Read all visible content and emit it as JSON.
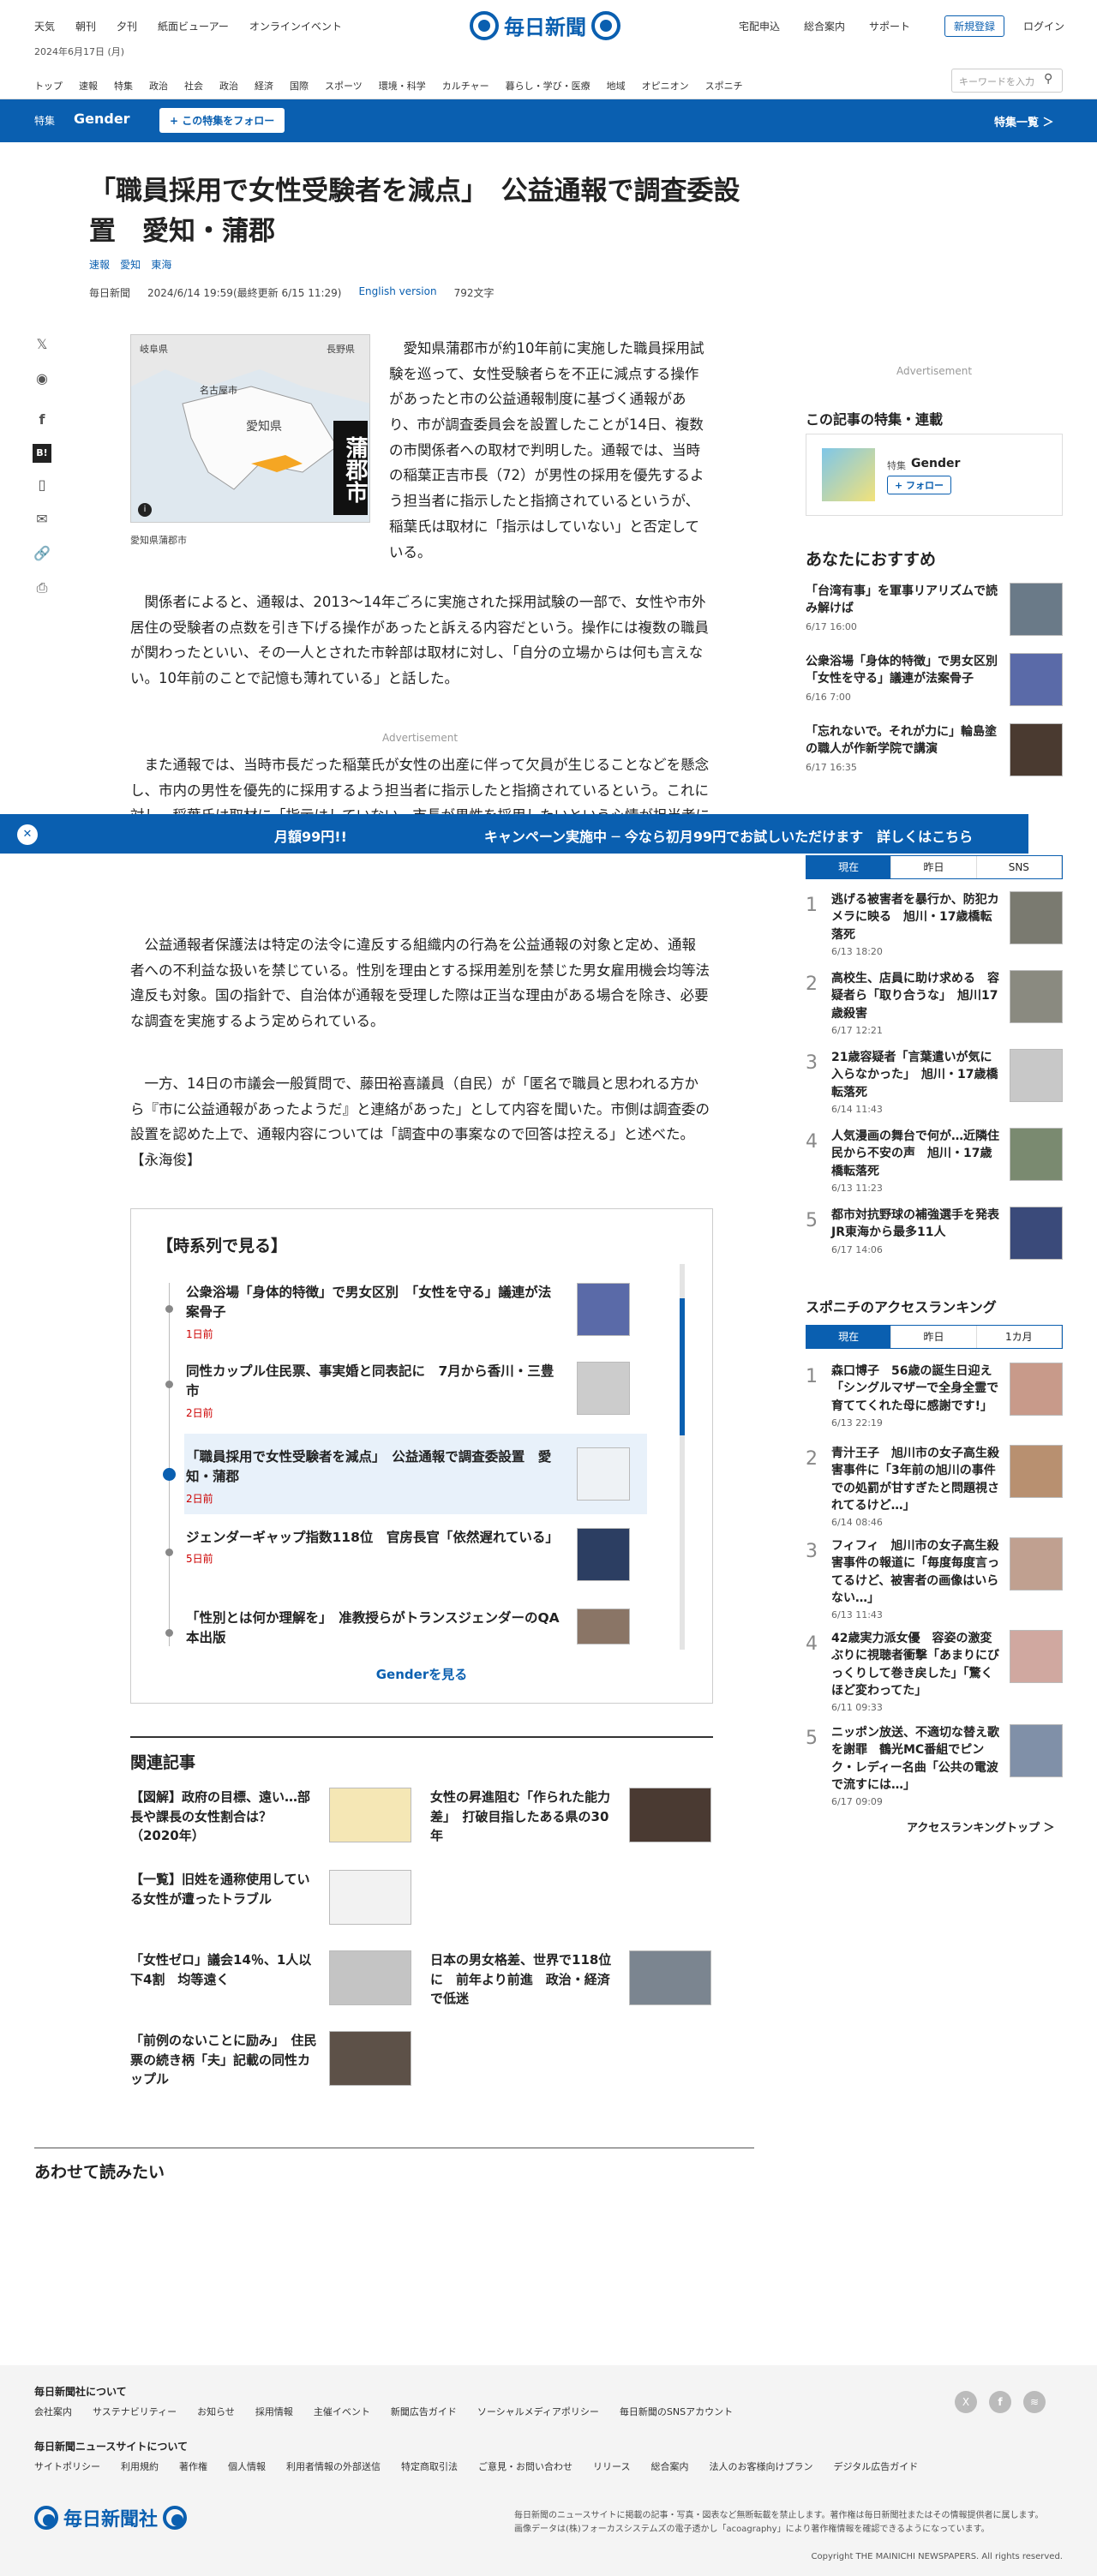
{
  "header": {
    "left_nav": [
      "天気",
      "朝刊",
      "夕刊",
      "紙面ビューアー",
      "オンラインイベント"
    ],
    "date": "2024年6月17日 (月)",
    "logo_text": "毎日新聞",
    "right_nav": [
      "宅配申込",
      "総合案内",
      "サポート"
    ],
    "register_label": "新規登録",
    "login_label": "ログイン",
    "categories": [
      "トップ",
      "速報",
      "特集",
      "政治",
      "社会",
      "政治",
      "経済",
      "国際",
      "スポーツ",
      "環境・科学",
      "カルチャー",
      "暮らし・学び・医療",
      "地域",
      "オピニオン",
      "スポニチ"
    ],
    "search_placeholder": "キーワードを入力"
  },
  "feature_band": {
    "kicker": "特集",
    "name": "Gender",
    "follow_label": "+ この特集をフォロー",
    "list_label": "特集一覧 ＞"
  },
  "article": {
    "title": "「職員採用で女性受験者を減点」　公益通報で調査委設置　愛知・蒲郡",
    "tags": [
      "速報",
      "愛知",
      "東海"
    ],
    "source": "毎日新聞",
    "datetime": "2024/6/14 19:59(最終更新 6/15 11:29)",
    "english_version": "English version",
    "chars": "792文字",
    "map_labels": {
      "pref_left": "岐阜県",
      "pref_right": "長野県",
      "city": "名古屋市",
      "pref": "愛知県",
      "target": "蒲郡市"
    },
    "map_caption": "愛知県蒲郡市",
    "p1": "　愛知県蒲郡市が約10年前に実施した職員採用試験を巡って、女性受験者らを不正に減点する操作があったと市の公益通報制度に基づく通報があり、市が調査委員会を設置したことが14日、複数の市関係者への取材で判明した。通報では、当時の稲葉正吉市長（72）が男性の採用を優先するよう担当者に指示したと指摘されているというが、稲葉氏は取材に「指示はしていない」と否定している。",
    "p2": "　関係者によると、通報は、2013～14年ごろに実施された採用試験の一部で、女性や市外居住の受験者の点数を引き下げる操作があったと訴える内容だという。操作には複数の職員が関わったといい、その一人とされた市幹部は取材に対し、「自分の立場からは何も言えない。10年前のことで記憶も薄れている」と話した。",
    "ad_label": "Advertisement",
    "p3": "　また通報では、当時市長だった稲葉氏が女性の出産に伴って欠員が生じることなどを懸念し、市内の男性を優先的に採用するよう担当者に指示したと指摘されているという。これに対し、稲葉氏は取材に「指示はしていない。市長が男性を採用したいという心情が担当者にはあると思う。だが、試験はあくまで公平でなければならない」と語った。",
    "p4": "　公益通報者保護法は特定の法令に違反する組織内の行為を公益通報の対象と定め、通報者への不利益な扱いを禁じている。性別を理由とする採用差別を禁じた男女雇用機会均等法違反も対象。国の指針で、自治体が通報を受理した際は正当な理由がある場合を除き、必要な調査を実施するよう定められている。",
    "p5": "　一方、14日の市議会一般質問で、藤田裕喜議員（自民）が「匿名で職員と思われる方から『市に公益通報があったようだ』と連絡があった」として内容を聞いた。市側は調査委の設置を認めた上で、通報内容については「調査中の事案なので回答は控える」と述べた。【永海俊】"
  },
  "banner": {
    "text": "月額99円!!　　　　　　　　　　キャンペーン実施中 ─ 今なら初月99円でお試しいただけます　詳しくはこちら"
  },
  "timeline": {
    "heading": "【時系列で見る】",
    "items": [
      {
        "title": "公衆浴場「身体的特徴」で男女区別　「女性を守る」議連が法案骨子",
        "date": "1日前"
      },
      {
        "title": "同性カップル住民票、事実婚と同表記に　7月から香川・三豊市",
        "date": "2日前"
      },
      {
        "title": "「職員採用で女性受験者を減点」　公益通報で調査委設置　愛知・蒲郡",
        "date": "2日前"
      },
      {
        "title": "ジェンダーギャップ指数118位　官房長官「依然遅れている」",
        "date": "5日前"
      },
      {
        "title": "「性別とは何か理解を」　准教授らがトランスジェンダーのQA本出版",
        "date": ""
      }
    ],
    "more_label": "Genderを見る"
  },
  "related": {
    "heading": "関連記事",
    "items": [
      {
        "title": "【図解】政府の目標、遠い…部長や課長の女性割合は？（2020年）"
      },
      {
        "title": "女性の昇進阻む「作られた能力差」　打破目指したある県の30年"
      },
      {
        "title": "【一覧】旧姓を通称使用している女性が遭ったトラブル"
      },
      {
        "title": "「女性ゼロ」議会14％、1人以下4割　均等遠く"
      },
      {
        "title": "日本の男女格差、世界で118位に　前年より前進　政治・経済で低迷"
      },
      {
        "title": "「前例のないことに励み」　住民票の続き柄「夫」記載の同性カップル"
      }
    ]
  },
  "read_also": {
    "heading": "あわせて読みたい"
  },
  "right": {
    "ad_label": "Advertisement",
    "feature_heading": "この記事の特集・連載",
    "feature_kicker": "特集",
    "feature_name": "Gender",
    "feature_follow": "+ フォロー",
    "reco_heading": "あなたにおすすめ",
    "reco": [
      {
        "title": "「台湾有事」を軍事リアリズムで読み解けば",
        "date": "6/17 16:00"
      },
      {
        "title": "公衆浴場「身体的特徴」で男女区別「女性を守る」議連が法案骨子",
        "date": "6/16 7:00"
      },
      {
        "title": "「忘れないで。それが力に」輪島塗の職人が作新学院で講演",
        "date": "6/17 16:35"
      }
    ],
    "tabs1": [
      "現在",
      "昨日",
      "SNS"
    ],
    "rank1": [
      {
        "n": "1",
        "title": "逃げる被害者を暴行か、防犯カメラに映る　旭川・17歳橋転落死",
        "date": "6/13 18:20"
      },
      {
        "n": "2",
        "title": "高校生、店員に助け求める　容疑者ら「取り合うな」　旭川17歳殺害",
        "date": "6/17 12:21"
      },
      {
        "n": "3",
        "title": "21歳容疑者「言葉遣いが気に入らなかった」　旭川・17歳橋転落死",
        "date": "6/14 11:43"
      },
      {
        "n": "4",
        "title": "人気漫画の舞台で何が…近隣住民から不安の声　旭川・17歳橋転落死",
        "date": "6/13 11:23"
      },
      {
        "n": "5",
        "title": "都市対抗野球の補強選手を発表　JR東海から最多11人",
        "date": "6/17 14:06"
      }
    ],
    "sponichi_heading": "スポニチのアクセスランキング",
    "tabs2": [
      "現在",
      "昨日",
      "1カ月"
    ],
    "rank2": [
      {
        "n": "1",
        "title": "森口博子　56歳の誕生日迎え「シングルマザーで全身全霊で育ててくれた母に感謝です!」",
        "date": "6/13 22:19"
      },
      {
        "n": "2",
        "title": "青汁王子　旭川市の女子高生殺害事件に「3年前の旭川の事件での処罰が甘すぎたと問題視されてるけど…」",
        "date": "6/14 08:46"
      },
      {
        "n": "3",
        "title": "フィフィ　旭川市の女子高生殺害事件の報道に「毎度毎度言ってるけど、被害者の画像はいらない…」",
        "date": "6/13 11:43"
      },
      {
        "n": "4",
        "title": "42歳実力派女優　容姿の激変ぶりに視聴者衝撃「あまりにびっくりして巻き戻した」「驚くほど変わってた」",
        "date": "6/11 09:33"
      },
      {
        "n": "5",
        "title": "ニッポン放送、不適切な替え歌を謝罪　鶴光MC番組でピンク・レディー名曲「公共の電波で流すには…」",
        "date": "6/17 09:09"
      }
    ],
    "rank_more": "アクセスランキングトップ ＞"
  },
  "share_icons": [
    "x-icon",
    "hatena-icon",
    "facebook-icon",
    "b-icon",
    "bookmark-icon",
    "mail-icon",
    "link-icon",
    "print-icon"
  ],
  "footer": {
    "about_heading": "毎日新聞社について",
    "about_links": [
      "会社案内",
      "サステナビリティー",
      "お知らせ",
      "採用情報",
      "主催イベント",
      "新聞広告ガイド",
      "ソーシャルメディアポリシー",
      "毎日新聞のSNSアカウント"
    ],
    "site_heading": "毎日新聞ニュースサイトについて",
    "site_links": [
      "サイトポリシー",
      "利用規約",
      "著作権",
      "個人情報",
      "利用者情報の外部送信",
      "特定商取引法",
      "ご意見・お問い合わせ",
      "リリース",
      "総合案内",
      "法人のお客様向けプラン",
      "デジタル広告ガイド"
    ],
    "logo_text": "毎日新聞社",
    "notice1": "毎日新聞のニュースサイトに掲載の記事・写真・図表など無断転載を禁止します。著作権は毎日新聞社またはその情報提供者に属します。",
    "notice2": "画像データは(株)フォーカスシステムズの電子透かし「acoagraphy」により著作権情報を確認できるようになっています。",
    "copyright": "Copyright THE MAINICHI NEWSPAPERS. All rights reserved."
  },
  "colors": {
    "brand": "#0a5fb0",
    "accent_red": "#cc0000"
  }
}
